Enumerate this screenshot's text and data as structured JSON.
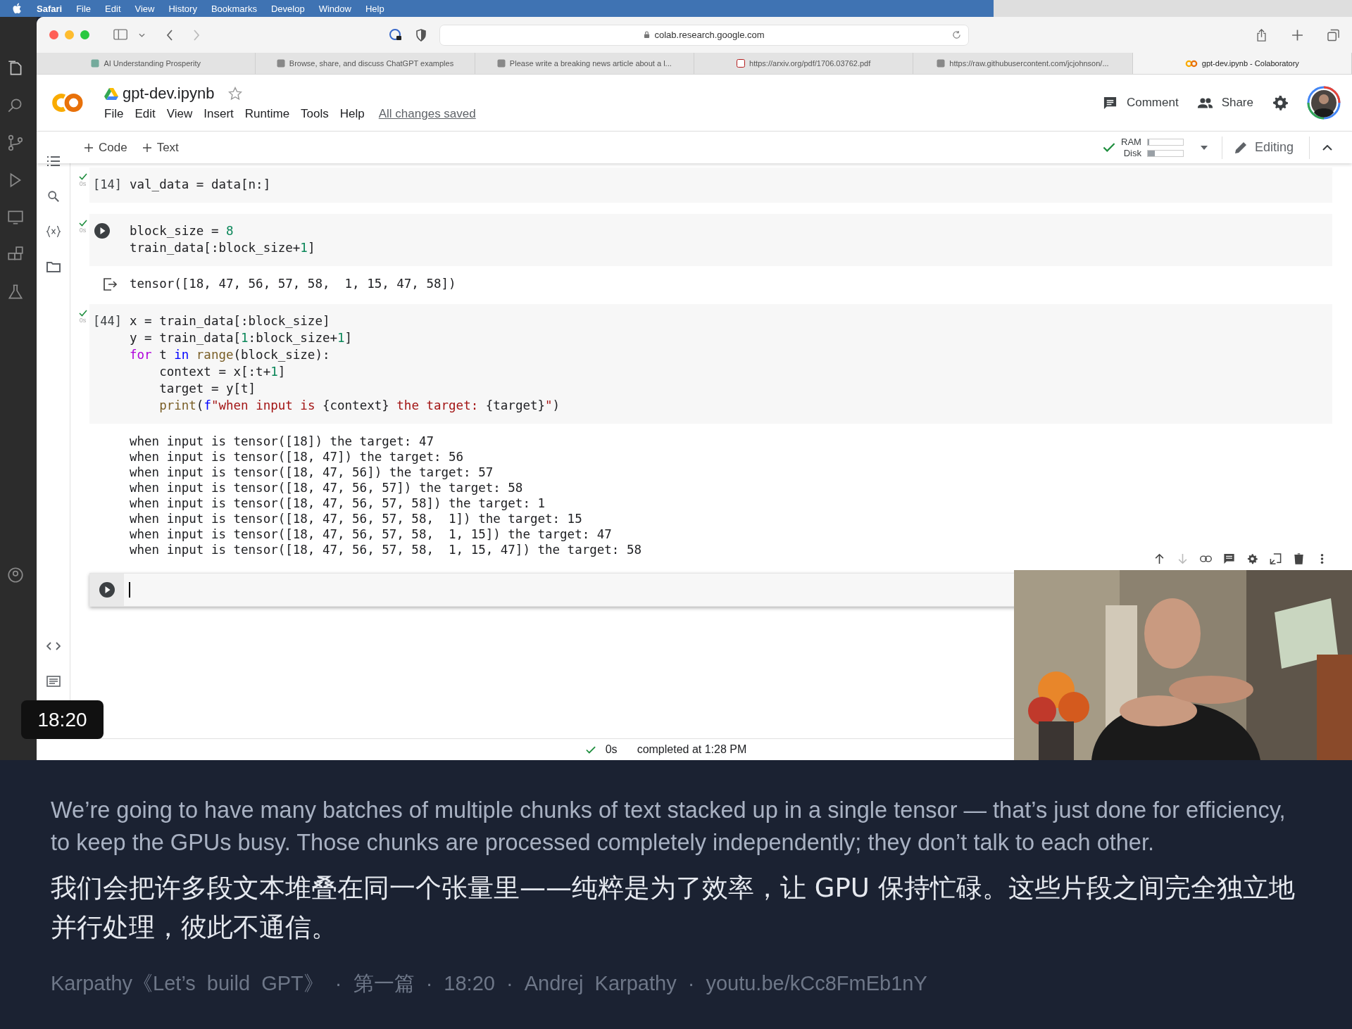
{
  "menu_bar": {
    "items": [
      "Safari",
      "File",
      "Edit",
      "View",
      "History",
      "Bookmarks",
      "Develop",
      "Window",
      "Help"
    ]
  },
  "browser": {
    "address": "colab.research.google.com",
    "tabs": [
      {
        "label": "AI Understanding Prosperity",
        "selected": false
      },
      {
        "label": "Browse, share, and discuss ChatGPT examples",
        "selected": false
      },
      {
        "label": "Please write a breaking news article about a l...",
        "selected": false
      },
      {
        "label": "https://arxiv.org/pdf/1706.03762.pdf",
        "selected": false
      },
      {
        "label": "https://raw.githubusercontent.com/jcjohnson/...",
        "selected": false
      },
      {
        "label": "gpt-dev.ipynb - Colaboratory",
        "selected": true
      }
    ]
  },
  "notebook": {
    "title": "gpt-dev.ipynb",
    "starred": false,
    "menu": [
      "File",
      "Edit",
      "View",
      "Insert",
      "Runtime",
      "Tools",
      "Help"
    ],
    "save_status": "All changes saved",
    "actions": [
      "Comment",
      "Share"
    ],
    "toolbar": {
      "add": [
        "Code",
        "Text"
      ],
      "ram": {
        "label": "RAM",
        "level": 0.05
      },
      "disk": {
        "label": "Disk",
        "level": 0.2
      },
      "mode": "Editing"
    },
    "cells": [
      {
        "count": "[14]",
        "succeeded": true,
        "time": "0s",
        "lines": [
          [
            {
              "text": "val_data = data[n:]",
              "kind": "plain"
            }
          ]
        ]
      },
      {
        "succeeded": true,
        "time": "0s",
        "lines": [
          [
            {
              "text": "block_size = ",
              "kind": "plain"
            },
            {
              "text": "8",
              "kind": "number"
            }
          ],
          [
            {
              "text": "train_data[:block_size+",
              "kind": "plain"
            },
            {
              "text": "1",
              "kind": "number"
            },
            {
              "text": "]",
              "kind": "plain"
            }
          ]
        ],
        "output_icon": true,
        "output": [
          "tensor([18, 47, 56, 57, 58,  1, 15, 47, 58])"
        ]
      },
      {
        "count": "[44]",
        "succeeded": true,
        "time": "0s",
        "lines": [
          [
            {
              "text": "x = train_data[:block_size]",
              "kind": "plain"
            }
          ],
          [
            {
              "text": "y = train_data[",
              "kind": "plain"
            },
            {
              "text": "1",
              "kind": "number"
            },
            {
              "text": ":block_size+",
              "kind": "plain"
            },
            {
              "text": "1",
              "kind": "number"
            },
            {
              "text": "]",
              "kind": "plain"
            }
          ],
          [
            {
              "text": "for",
              "kind": "keyword"
            },
            {
              "text": " t ",
              "kind": "plain"
            },
            {
              "text": "in ",
              "kind": "operator"
            },
            {
              "text": "range",
              "kind": "builtin"
            },
            {
              "text": "(block_size):",
              "kind": "plain"
            }
          ],
          [
            {
              "text": "    context = x[:t+",
              "kind": "plain"
            },
            {
              "text": "1",
              "kind": "number"
            },
            {
              "text": "]",
              "kind": "plain"
            }
          ],
          [
            {
              "text": "    target = y[t]",
              "kind": "plain"
            }
          ],
          [
            {
              "text": "    print",
              "kind": "builtin"
            },
            {
              "text": "(",
              "kind": "plain"
            },
            {
              "text": "f",
              "kind": "operator"
            },
            {
              "text": "\"when input is ",
              "kind": "string"
            },
            {
              "text": "{context}",
              "kind": "plain"
            },
            {
              "text": " the target: ",
              "kind": "string"
            },
            {
              "text": "{target}",
              "kind": "plain"
            },
            {
              "text": "\"",
              "kind": "string"
            },
            {
              "text": ")",
              "kind": "plain"
            }
          ]
        ],
        "output_icon": false,
        "output": [
          "when input is tensor([18]) the target: 47",
          "when input is tensor([18, 47]) the target: 56",
          "when input is tensor([18, 47, 56]) the target: 57",
          "when input is tensor([18, 47, 56, 57]) the target: 58",
          "when input is tensor([18, 47, 56, 57, 58]) the target: 1",
          "when input is tensor([18, 47, 56, 57, 58,  1]) the target: 15",
          "when input is tensor([18, 47, 56, 57, 58,  1, 15]) the target: 47",
          "when input is tensor([18, 47, 56, 57, 58,  1, 15, 47]) the target: 58"
        ]
      }
    ],
    "empty_cell": {
      "focused": true
    },
    "status": {
      "time": "0s",
      "message": "completed at 1:28 PM"
    }
  },
  "video": {
    "timestamp": "18:20"
  },
  "subtitles": {
    "english": "We’re going to have many batches of multiple chunks of text stacked up in a single tensor — that’s just done for efficiency, to keep the GPUs busy. Those chunks are processed completely independently; they don’t talk to each other.",
    "chinese": "我们会把许多段文本堆叠在同一个张量里——纯粹是为了效率，让 GPU 保持忙碌。这些片段之间完全独立地并行处理，彼此不通信。",
    "source": "Karpathy《Let’s build GPT》 · 第一篇 · 18:20 · Andrej Karpathy · youtu.be/kCc8FmEb1nY"
  }
}
